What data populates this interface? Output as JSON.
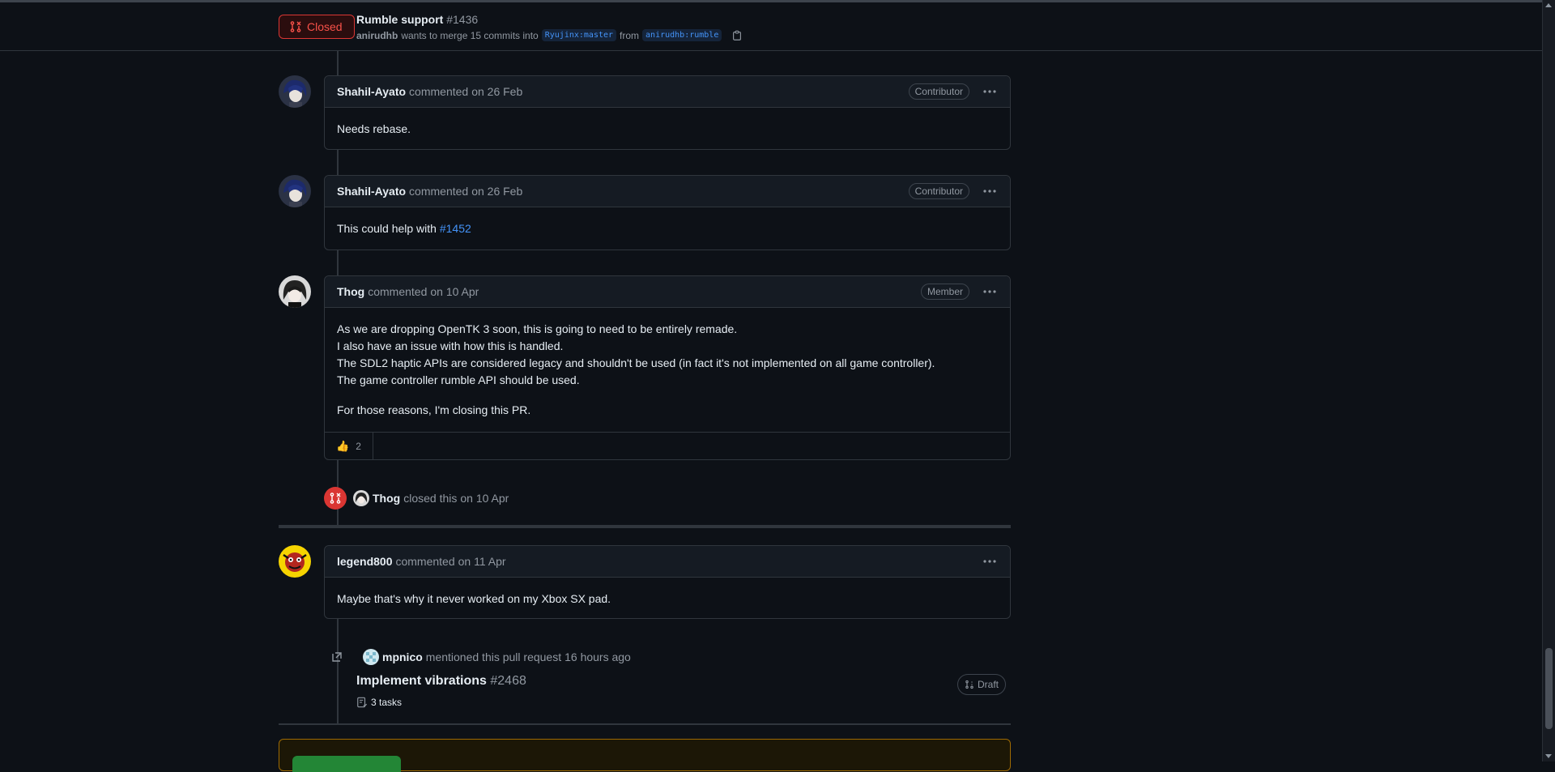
{
  "header": {
    "state": "Closed",
    "title": "Rumble support",
    "number": "#1436",
    "author": "anirudhb",
    "merge_text_1": "wants to merge 15 commits into",
    "base_branch": "Ryujinx:master",
    "from_text": "from",
    "head_branch": "anirudhb:rumble"
  },
  "comments": [
    {
      "author": "Shahil-Ayato",
      "action": "commented",
      "date": "on 26 Feb",
      "role": "Contributor",
      "body": [
        "Needs rebase."
      ]
    },
    {
      "author": "Shahil-Ayato",
      "action": "commented",
      "date": "on 26 Feb",
      "role": "Contributor",
      "body_prefix": "This could help with",
      "body_link": "#1452"
    },
    {
      "author": "Thog",
      "action": "commented",
      "date": "on 10 Apr",
      "role": "Member",
      "body": [
        "As we are dropping OpenTK 3 soon, this is going to need to be entirely remade.",
        "I also have an issue with how this is handled.",
        "The SDL2 haptic APIs are considered legacy and shouldn't be used (in fact it's not implemented on all game controller).",
        "The game controller rumble API should be used.",
        "For those reasons, I'm closing this PR."
      ],
      "reaction_emoji": "👍",
      "reaction_count": "2"
    },
    {
      "author": "legend800",
      "action": "commented",
      "date": "on 11 Apr",
      "body": [
        "Maybe that's why it never worked on my Xbox SX pad."
      ]
    }
  ],
  "close_event": {
    "actor": "Thog",
    "text": "closed this",
    "date": "on 10 Apr"
  },
  "mention_event": {
    "actor": "mpnico",
    "text": "mentioned this pull request",
    "time": "16 hours ago",
    "pr_title": "Implement vibrations",
    "pr_number": "#2468",
    "tasks": "3 tasks",
    "status": "Draft"
  },
  "colors": {
    "closed": "#da3633",
    "link": "#4493f8",
    "background": "#0d1117"
  }
}
